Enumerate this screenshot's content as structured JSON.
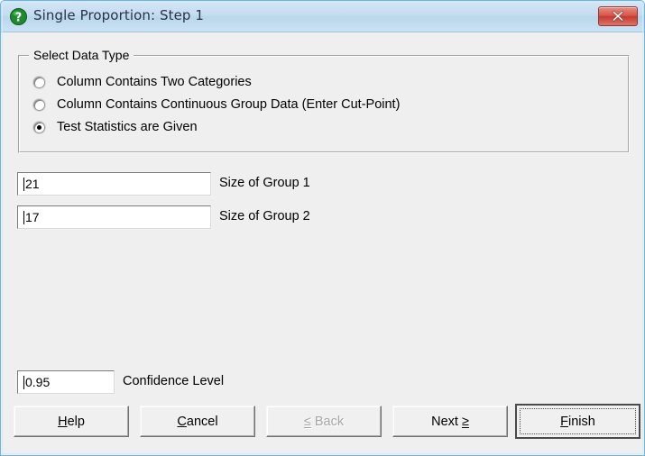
{
  "window": {
    "title": "Single Proportion: Step 1",
    "title_icon": "question-mark-icon",
    "close_label": "x",
    "accent_border_color": "#6ab4e0",
    "titlebar_color": "#c5ddf0",
    "background_color": "#efefef"
  },
  "groupbox": {
    "legend": "Select Data Type",
    "options": [
      {
        "label": "Column Contains Two Categories",
        "selected": false
      },
      {
        "label": "Column Contains Continuous Group Data (Enter Cut-Point)",
        "selected": false
      },
      {
        "label": "Test Statistics are Given",
        "selected": true
      }
    ]
  },
  "fields": [
    {
      "value": "21",
      "label": "Size of Group 1"
    },
    {
      "value": "17",
      "label": "Size of Group 2"
    }
  ],
  "confidence": {
    "value": "0.95",
    "label": "Confidence Level"
  },
  "buttons": {
    "help": {
      "accel": "H",
      "rest": "elp",
      "disabled": false,
      "default": false
    },
    "cancel": {
      "accel": "C",
      "rest": "ancel",
      "disabled": false,
      "default": false
    },
    "back": {
      "glyph": "≤",
      "text": " Back",
      "disabled": true,
      "default": false
    },
    "next": {
      "text": "Next ",
      "glyph": "≥",
      "disabled": false,
      "default": false
    },
    "finish": {
      "accel": "F",
      "rest": "inish",
      "disabled": false,
      "default": true
    }
  }
}
